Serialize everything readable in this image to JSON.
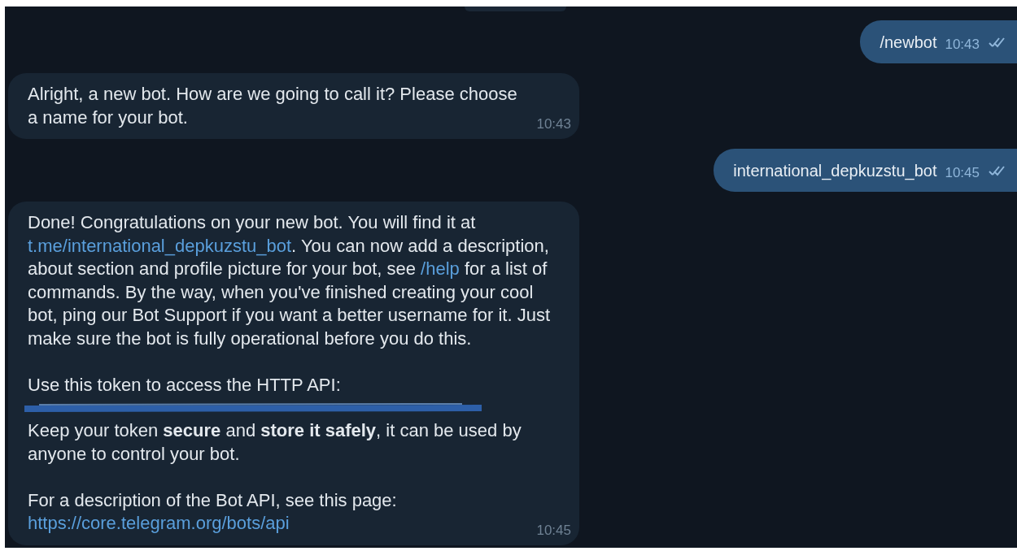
{
  "messages": [
    {
      "kind": "outgoing",
      "text": "/newbot",
      "time": "10:43",
      "read": true
    },
    {
      "kind": "incoming",
      "sections": [
        [
          {
            "kind": "paragraph",
            "segments": [
              {
                "kind": "text",
                "text": "Alright, a new bot. How are we going to call it? Please choose a name for your bot."
              }
            ]
          }
        ]
      ],
      "time": "10:43"
    },
    {
      "kind": "outgoing",
      "text": "international_depkuzstu_bot",
      "time": "10:45",
      "read": true
    },
    {
      "kind": "incoming",
      "sections": [
        [
          {
            "kind": "paragraph",
            "segments": [
              {
                "kind": "text",
                "text": "Done! Congratulations on your new bot. You will find it at "
              },
              {
                "kind": "link",
                "text": "t.me/international_depkuzstu_bot"
              },
              {
                "kind": "text",
                "text": ". You can now add a description, about section and profile picture for your bot, see "
              },
              {
                "kind": "link",
                "text": "/help"
              },
              {
                "kind": "text",
                "text": " for a list of commands. By the way, when you've finished creating your cool bot, ping our Bot Support if you want a better username for it. Just make sure the bot is fully operational before you do this."
              }
            ]
          }
        ],
        [
          {
            "kind": "paragraph",
            "segments": [
              {
                "kind": "text",
                "text": "Use this token to access the HTTP API:"
              }
            ]
          },
          {
            "kind": "redaction"
          },
          {
            "kind": "paragraph",
            "segments": [
              {
                "kind": "text",
                "text": "Keep your token **secure** and **store it safely**, it can be used by anyone to control your bot."
              }
            ]
          }
        ],
        [
          {
            "kind": "paragraph",
            "segments": [
              {
                "kind": "text",
                "text": "For a description of the Bot API, see this page: "
              },
              {
                "kind": "link",
                "text": "https://core.telegram.org/bots/api"
              }
            ]
          }
        ]
      ],
      "time": "10:45"
    }
  ]
}
